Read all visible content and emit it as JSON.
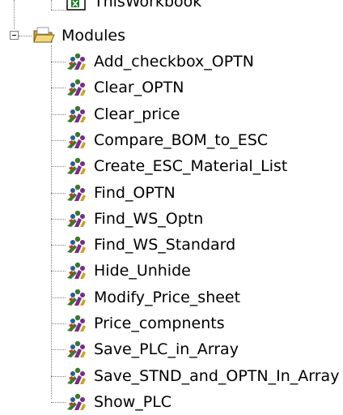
{
  "tree": {
    "workbook_item": {
      "label": "ThisWorkbook",
      "icon": "excel-workbook-icon"
    },
    "modules_folder": {
      "label": "Modules",
      "icon": "folder-open-icon",
      "expanded": true
    },
    "modules": [
      {
        "label": "Add_checkbox_OPTN",
        "icon": "module-icon"
      },
      {
        "label": "Clear_OPTN",
        "icon": "module-icon"
      },
      {
        "label": "Clear_price",
        "icon": "module-icon"
      },
      {
        "label": "Compare_BOM_to_ESC",
        "icon": "module-icon"
      },
      {
        "label": "Create_ESC_Material_List",
        "icon": "module-icon"
      },
      {
        "label": "Find_OPTN",
        "icon": "module-icon"
      },
      {
        "label": "Find_WS_Optn",
        "icon": "module-icon"
      },
      {
        "label": "Find_WS_Standard",
        "icon": "module-icon"
      },
      {
        "label": "Hide_Unhide",
        "icon": "module-icon"
      },
      {
        "label": "Modify_Price_sheet",
        "icon": "module-icon"
      },
      {
        "label": "Price_compnents",
        "icon": "module-icon"
      },
      {
        "label": "Save_PLC_in_Array",
        "icon": "module-icon"
      },
      {
        "label": "Save_STND_and_OPTN_In_Array",
        "icon": "module-icon"
      },
      {
        "label": "Show_PLC",
        "icon": "module-icon"
      }
    ]
  }
}
